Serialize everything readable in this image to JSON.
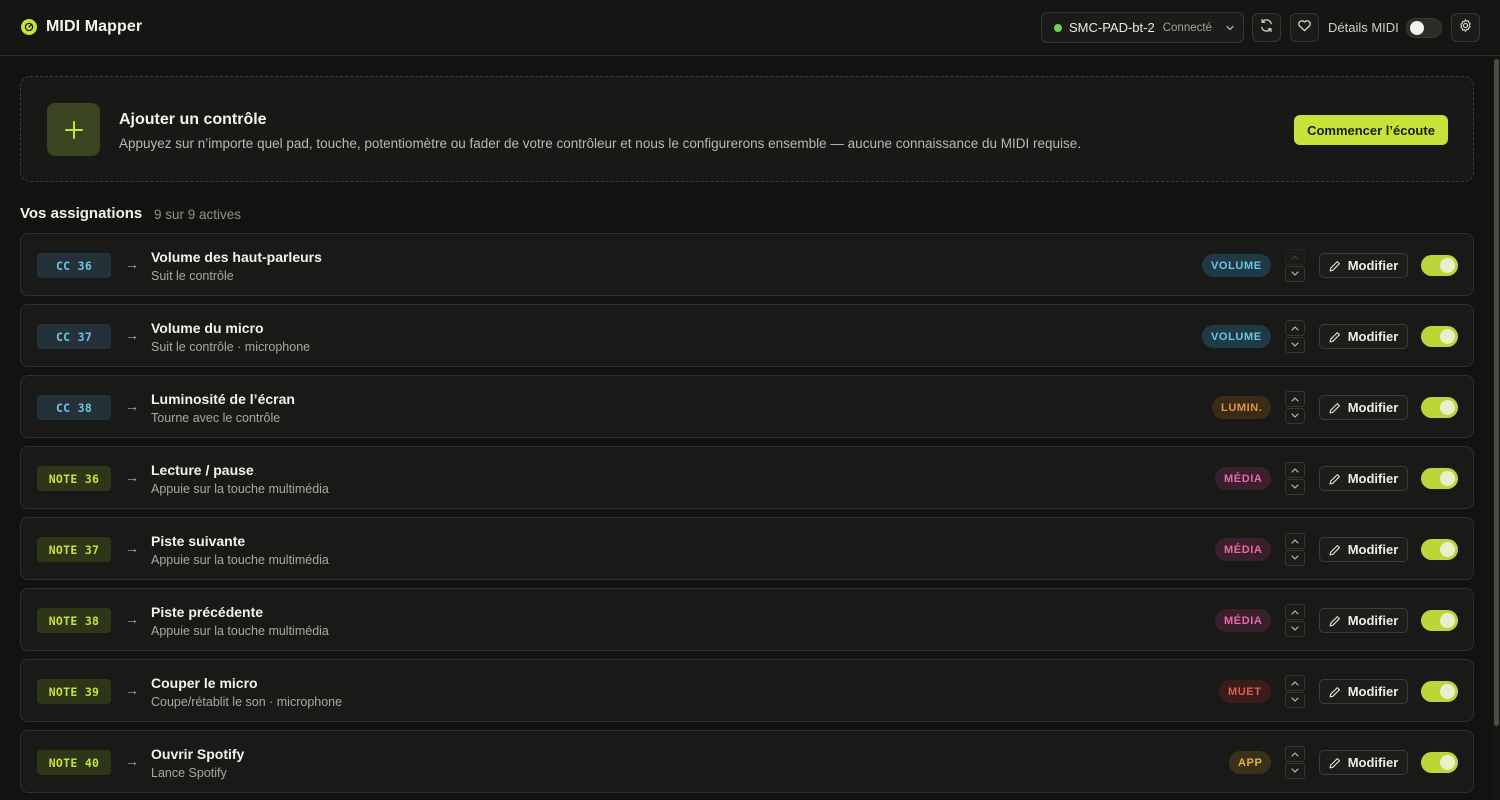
{
  "app": {
    "title": "MIDI Mapper"
  },
  "header": {
    "device_name": "SMC-PAD-bt-2",
    "device_status": "Connecté",
    "midi_details_label": "Détails MIDI",
    "midi_details_on": false
  },
  "add_panel": {
    "title": "Ajouter un contrôle",
    "description": "Appuyez sur n’importe quel pad, touche, potentiomètre ou fader de votre contrôleur et nous le configurerons ensemble — aucune connaissance du MIDI requise.",
    "button_label": "Commencer l’écoute"
  },
  "assignments": {
    "title": "Vos assignations",
    "count": "9 sur 9 actives",
    "edit_label": "Modifier",
    "arrow": "→",
    "rows": [
      {
        "trigger": "CC 36",
        "kind": "cc",
        "title": "Volume des haut-parleurs",
        "subtitle": "Suit le contrôle",
        "badge": "VOLUME",
        "badge_kind": "volume",
        "enabled": true,
        "can_move_up": false
      },
      {
        "trigger": "CC 37",
        "kind": "cc",
        "title": "Volume du micro",
        "subtitle": "Suit le contrôle · microphone",
        "badge": "VOLUME",
        "badge_kind": "volume",
        "enabled": true,
        "can_move_up": true
      },
      {
        "trigger": "CC 38",
        "kind": "cc",
        "title": "Luminosité de l’écran",
        "subtitle": "Tourne avec le contrôle",
        "badge": "LUMIN.",
        "badge_kind": "lumin",
        "enabled": true,
        "can_move_up": true
      },
      {
        "trigger": "NOTE 36",
        "kind": "note",
        "title": "Lecture / pause",
        "subtitle": "Appuie sur la touche multimédia",
        "badge": "MÉDIA",
        "badge_kind": "media",
        "enabled": true,
        "can_move_up": true
      },
      {
        "trigger": "NOTE 37",
        "kind": "note",
        "title": "Piste suivante",
        "subtitle": "Appuie sur la touche multimédia",
        "badge": "MÉDIA",
        "badge_kind": "media",
        "enabled": true,
        "can_move_up": true
      },
      {
        "trigger": "NOTE 38",
        "kind": "note",
        "title": "Piste précédente",
        "subtitle": "Appuie sur la touche multimédia",
        "badge": "MÉDIA",
        "badge_kind": "media",
        "enabled": true,
        "can_move_up": true
      },
      {
        "trigger": "NOTE 39",
        "kind": "note",
        "title": "Couper le micro",
        "subtitle": "Coupe/rétablit le son · microphone",
        "badge": "MUET",
        "badge_kind": "muet",
        "enabled": true,
        "can_move_up": true
      },
      {
        "trigger": "NOTE 40",
        "kind": "note",
        "title": "Ouvrir Spotify",
        "subtitle": "Lance Spotify",
        "badge": "APP",
        "badge_kind": "app",
        "enabled": true,
        "can_move_up": true
      }
    ]
  },
  "colors": {
    "accent": "#c8e23a",
    "background": "#121311",
    "connected": "#6fd05a"
  }
}
